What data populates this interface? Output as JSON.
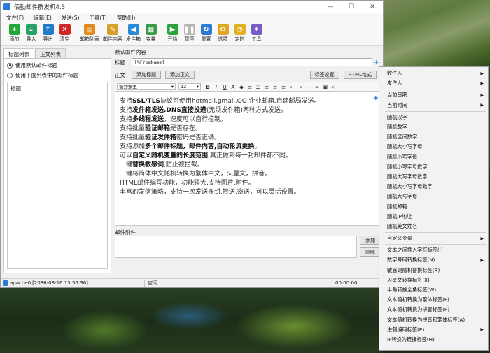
{
  "window": {
    "title": "佰勤邮件群发机4.3",
    "minimize": "—",
    "maximize": "☐",
    "close": "✕"
  },
  "menu": [
    "文件(F)",
    "编辑(E)",
    "发送(S)",
    "工具(T)",
    "帮助(H)"
  ],
  "toolbar": [
    {
      "label": "添加",
      "icon": "add-icon",
      "color": "#22a83a",
      "glyph": "+"
    },
    {
      "label": "导入",
      "icon": "import-icon",
      "color": "#2aa06a",
      "glyph": "↓"
    },
    {
      "label": "导出",
      "icon": "export-icon",
      "color": "#1f7ac9",
      "glyph": "↑"
    },
    {
      "label": "清空",
      "icon": "clear-icon",
      "color": "#d32626",
      "glyph": "✕"
    },
    {
      "label": "邮箱列表",
      "icon": "mailbox-list-icon",
      "color": "#e08a1e",
      "glyph": "▤"
    },
    {
      "label": "邮件内容",
      "icon": "mail-content-icon",
      "color": "#d6a12a",
      "glyph": "✎"
    },
    {
      "label": "发件箱",
      "icon": "outbox-icon",
      "color": "#2b8ad6",
      "glyph": "◀"
    },
    {
      "label": "变量",
      "icon": "variable-icon",
      "color": "#3b9a46",
      "glyph": "▦"
    },
    {
      "label": "开始",
      "icon": "start-icon",
      "color": "#2aa33e",
      "glyph": "▶"
    },
    {
      "label": "暂停",
      "icon": "pause-icon",
      "color": "#b5b5b5",
      "glyph": "❚❚"
    },
    {
      "label": "重置",
      "icon": "reset-icon",
      "color": "#2b7bd6",
      "glyph": "↻"
    },
    {
      "label": "选项",
      "icon": "options-icon",
      "color": "#e0a820",
      "glyph": "⚙"
    },
    {
      "label": "定时",
      "icon": "timer-icon",
      "color": "#e0b020",
      "glyph": "◔"
    },
    {
      "label": "工具",
      "icon": "tools-icon",
      "color": "#7a5cc8",
      "glyph": "✦"
    }
  ],
  "left": {
    "tabs": [
      "标题列表",
      "正文列表"
    ],
    "radio_default": "使用默认邮件标题",
    "radio_list": "使用下面列表中的邮件标题",
    "list_header": "标题"
  },
  "right": {
    "section_title": "默认邮件内容",
    "subject_label": "标题",
    "subject_value": "[%FromName]",
    "body_label": "正文",
    "add_subject_btn": "添加标题",
    "add_body_btn": "添加正文",
    "tag_settings_btn": "标签设置",
    "html_format_btn": "HTML格式",
    "font_name": "微软雅黑",
    "font_size": "12",
    "body_lines": [
      {
        "pre": "支持",
        "bold": "SSL/TLS",
        "post": "协议可使用hotmail.gmail.QQ.企业邮箱.自建邮局发送。"
      },
      {
        "pre": "支持",
        "bold": "发件箱发送.DNS直接投递",
        "post": "(无须发件箱)两种方式发送。"
      },
      {
        "pre": "支持",
        "bold": "多线程发送",
        "post": "，速度可以自行控制。"
      },
      {
        "pre": "支持批量",
        "bold": "验证邮箱",
        "post": "是否存在。"
      },
      {
        "pre": "支持批量",
        "bold": "验证发件箱",
        "post": "密码是否正确。"
      },
      {
        "pre": "支持添加",
        "bold": "多个邮件标题，邮件内容,自动轮流更换",
        "post": "。"
      },
      {
        "pre": "可以",
        "bold": "自定义随机变量的长度范围",
        "post": ",真正做到每一封邮件都不同。"
      },
      {
        "pre": "一键",
        "bold": "替换敏感词",
        "post": ",防止被拦截。"
      },
      {
        "pre": "一键将简体中文随机转换为繁体中文，火星文，拼音。",
        "bold": "",
        "post": ""
      },
      {
        "pre": "HTML邮件编写功能，功能强大,支持图片,附件。",
        "bold": "",
        "post": ""
      },
      {
        "pre": "丰富的发信策略，支持一次发送多封,抄送,密送，可以灵活设置。",
        "bold": "",
        "post": ""
      }
    ],
    "attach_label": "邮件附件",
    "attach_add": "添加",
    "attach_delete": "删除"
  },
  "status": {
    "user": "apache0",
    "datetime": "[2036-08-16 13:56:36]",
    "state": "空闲",
    "timer": "00:00:00"
  },
  "context_menu": [
    {
      "label": "收件人",
      "submenu": true
    },
    {
      "label": "发件人",
      "submenu": true
    },
    {
      "sep": true
    },
    {
      "label": "当前日期",
      "submenu": true
    },
    {
      "label": "当前时间",
      "submenu": true
    },
    {
      "sep": true
    },
    {
      "label": "随机汉字",
      "submenu": false
    },
    {
      "label": "随机数字",
      "submenu": false
    },
    {
      "label": "随机区间数字",
      "submenu": false
    },
    {
      "label": "随机大小写字母",
      "submenu": false
    },
    {
      "label": "随机小写字母",
      "submenu": false
    },
    {
      "label": "随机小写字母数字",
      "submenu": false
    },
    {
      "label": "随机大写字母数字",
      "submenu": false
    },
    {
      "label": "随机大小写字母数字",
      "submenu": false
    },
    {
      "label": "随机大写字母",
      "submenu": false
    },
    {
      "label": "随机邮箱",
      "submenu": false
    },
    {
      "label": "随机IP地址",
      "submenu": false
    },
    {
      "label": "随机英文姓名",
      "submenu": false
    },
    {
      "sep": true
    },
    {
      "label": "自定义变量",
      "submenu": true
    },
    {
      "sep": true
    },
    {
      "label": "文本之间插入字符标签(I)",
      "submenu": false
    },
    {
      "label": "数字号码转换标签(N)",
      "submenu": true
    },
    {
      "label": "敏感词随机替换标签(R)",
      "submenu": false
    },
    {
      "label": "火星文转换标签(X)",
      "submenu": false
    },
    {
      "label": "半角转换全角标签(W)",
      "submenu": false
    },
    {
      "label": "文本随机转换为繁体标签(F)",
      "submenu": false
    },
    {
      "label": "文本随机转换为拼音标签(P)",
      "submenu": false
    },
    {
      "label": "文本随机转换为拼音和繁体标签(A)",
      "submenu": false
    },
    {
      "label": "进制编码标签(E)",
      "submenu": true
    },
    {
      "label": "IP转换为链接标签(H)",
      "submenu": false
    }
  ]
}
